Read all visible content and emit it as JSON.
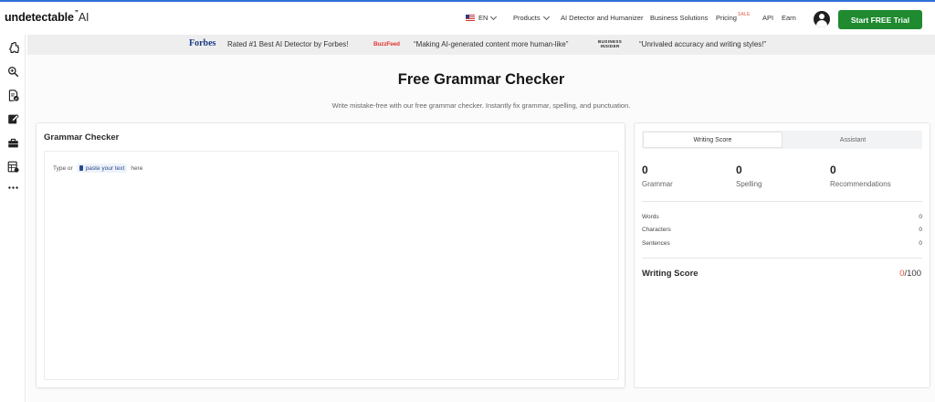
{
  "header": {
    "logo_text": "undetectable",
    "logo_ai": "AI",
    "language": "EN",
    "nav": [
      "Products",
      "AI Detector and Humanizer",
      "Business Solutions",
      "Pricing",
      "API",
      "Earn"
    ],
    "sale_badge": "SALE",
    "cta_label": "Start FREE Trial"
  },
  "sidebar": {
    "icons": [
      "puzzle-icon",
      "search-zoom-icon",
      "document-check-icon",
      "edit-note-icon",
      "briefcase-icon",
      "spreadsheet-icon",
      "more-icon"
    ]
  },
  "banner": {
    "forbes_logo": "Forbes",
    "forbes_quote": "Rated #1 Best AI Detector by Forbes!",
    "buzzfeed_logo": "BuzzFeed",
    "buzzfeed_quote": "“Making AI-generated content more human-like”",
    "bi_logo_line1": "BUSINESS",
    "bi_logo_line2": "INSIDER",
    "bi_quote": "“Unrivaled accuracy and writing styles!”"
  },
  "page": {
    "title": "Free Grammar Checker",
    "subtitle": "Write mistake-free with our free grammar checker. Instantly fix grammar, spelling, and punctuation."
  },
  "editor": {
    "title": "Grammar Checker",
    "placeholder_prefix": "Type or",
    "paste_label": "paste your text",
    "placeholder_suffix": "here"
  },
  "score_panel": {
    "tabs": [
      "Writing Score",
      "Assistant"
    ],
    "metrics": [
      {
        "value": "0",
        "label": "Grammar"
      },
      {
        "value": "0",
        "label": "Spelling"
      },
      {
        "value": "0",
        "label": "Recommendations"
      }
    ],
    "stats": [
      {
        "label": "Words",
        "value": "0"
      },
      {
        "label": "Characters",
        "value": "0"
      },
      {
        "label": "Sentences",
        "value": "0"
      }
    ],
    "writing_score_label": "Writing Score",
    "writing_score_value": "0",
    "writing_score_max": "/100"
  },
  "colors": {
    "accent_green": "#1f8a2f",
    "score_orange": "#e2553b",
    "forbes_blue": "#1a3b84",
    "buzzfeed_red": "#e3362e"
  }
}
